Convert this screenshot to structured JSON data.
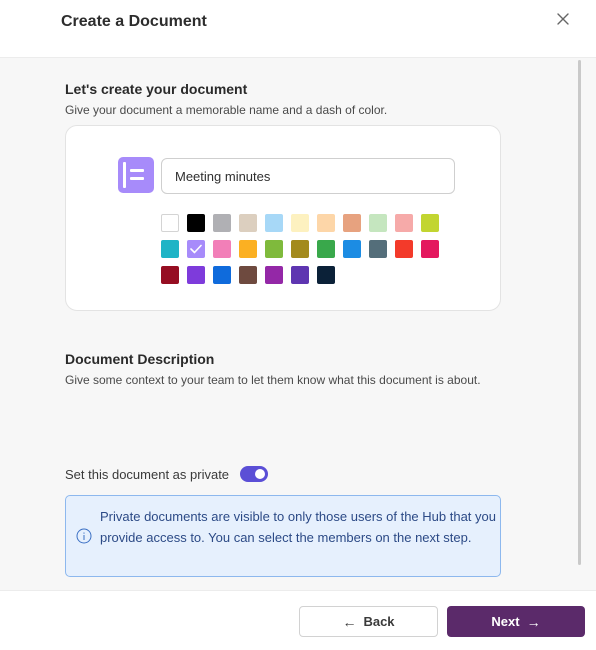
{
  "dialog": {
    "title": "Create a Document",
    "close_icon": "close-icon"
  },
  "create": {
    "heading": "Let's create your document",
    "subtitle": "Give your document a memorable name and a dash of color.",
    "name_value": "Meeting minutes",
    "doc_icon_color": "#a78bfa",
    "selected_color": "#a78bfa",
    "colors": [
      "#ffffff",
      "#000000",
      "#b0b0b4",
      "#dccfbf",
      "#a7d8f7",
      "#fdf1c0",
      "#fdd6a8",
      "#e7a27f",
      "#c5e6bf",
      "#f6aaa9",
      "#c2d531",
      "#1fb4c6",
      "#a78bfa",
      "#f27fb8",
      "#fbb022",
      "#7fba3c",
      "#a38a1d",
      "#39a84b",
      "#1c8ce3",
      "#546e7a",
      "#f33a2a",
      "#e4185e",
      "#960d22",
      "#7e3bdb",
      "#0f6bdc",
      "#6e4a3f",
      "#9428a7",
      "#5e35b1",
      "#0b2138"
    ]
  },
  "description": {
    "heading": "Document Description",
    "text": "Give some context to your team to let them know what this document is about."
  },
  "privacy": {
    "label": "Set this document as private",
    "enabled": true,
    "info_text": "Private documents are visible to only those users of the Hub that you provide access to. You can select the members on the next step."
  },
  "footer": {
    "back_arrow": "←",
    "back_label": "Back",
    "next_label": "Next",
    "next_arrow": "→"
  }
}
